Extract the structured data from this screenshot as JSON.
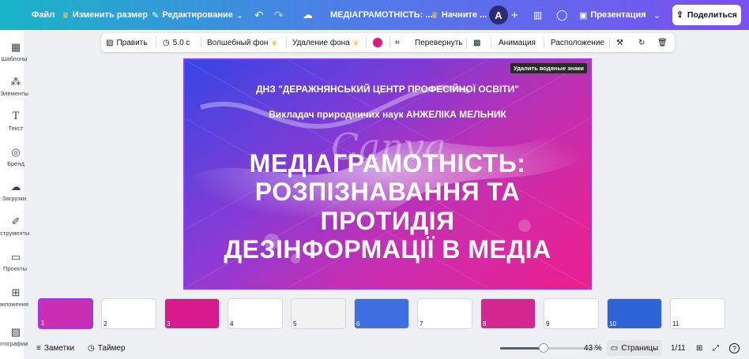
{
  "topbar": {
    "file": "Файл",
    "resize": "Изменить размер",
    "editing": "Редактирование",
    "doc_title": "МЕДІАГРАМОТНІСТЬ: ...",
    "trial": "Начните ...",
    "avatar": "A",
    "present": "Презентация",
    "share": "Поделиться"
  },
  "sidebar": {
    "items": [
      {
        "label": "Шаблоны",
        "icon": "templates-icon"
      },
      {
        "label": "Элементы",
        "icon": "elements-icon"
      },
      {
        "label": "Текст",
        "icon": "text-icon"
      },
      {
        "label": "Бренд",
        "icon": "brand-icon"
      },
      {
        "label": "Загрузки",
        "icon": "uploads-icon"
      },
      {
        "label": "Инструменты",
        "icon": "tools-icon"
      },
      {
        "label": "Проекты",
        "icon": "projects-icon"
      },
      {
        "label": "Приложения",
        "icon": "apps-icon"
      },
      {
        "label": "Фотографии",
        "icon": "photos-icon"
      }
    ]
  },
  "toolbar": {
    "edit": "Править",
    "duration": "5.0 с",
    "magic_bg": "Волшебный фон",
    "remove_bg": "Удаление фона",
    "accent_color": "#d81b7c",
    "flip": "Перевернуть",
    "animation": "Анимация",
    "position": "Расположение"
  },
  "slide": {
    "remove_watermark": "Удалить водяные знаки",
    "line1": "ДНЗ \"ДЕРАЖНЯНСЬКИЙ ЦЕНТР ПРОФЕСІЙНОЇ ОСВІТИ\"",
    "line2": "Викладач природничих наук АНЖЕЛІКА МЕЛЬНИК",
    "title_lines": [
      "МЕДІАГРАМОТНІСТЬ:",
      "РОЗПІЗНАВАННЯ ТА",
      "ПРОТИДІЯ",
      "ДЕЗІНФОРМАЦІЇ В МЕДІА"
    ],
    "watermark": "Canva"
  },
  "thumbnails": [
    {
      "num": "1",
      "bg": "#c92fb5",
      "dark": true
    },
    {
      "num": "2",
      "bg": "#ffffff",
      "dark": false
    },
    {
      "num": "3",
      "bg": "#d81b8c",
      "dark": true
    },
    {
      "num": "4",
      "bg": "#ffffff",
      "dark": false
    },
    {
      "num": "5",
      "bg": "#f2f2f2",
      "dark": false
    },
    {
      "num": "6",
      "bg": "#3d6fe0",
      "dark": true
    },
    {
      "num": "7",
      "bg": "#ffffff",
      "dark": false
    },
    {
      "num": "8",
      "bg": "#d4268f",
      "dark": true
    },
    {
      "num": "9",
      "bg": "#ffffff",
      "dark": false
    },
    {
      "num": "10",
      "bg": "#2f63d8",
      "dark": true
    },
    {
      "num": "11",
      "bg": "#ffffff",
      "dark": false
    }
  ],
  "bottombar": {
    "notes": "Заметки",
    "timer": "Таймер",
    "zoom": "43 %",
    "zoom_value": 0.43,
    "pages": "Страницы",
    "page_counter": "1/11",
    "help": "?"
  }
}
